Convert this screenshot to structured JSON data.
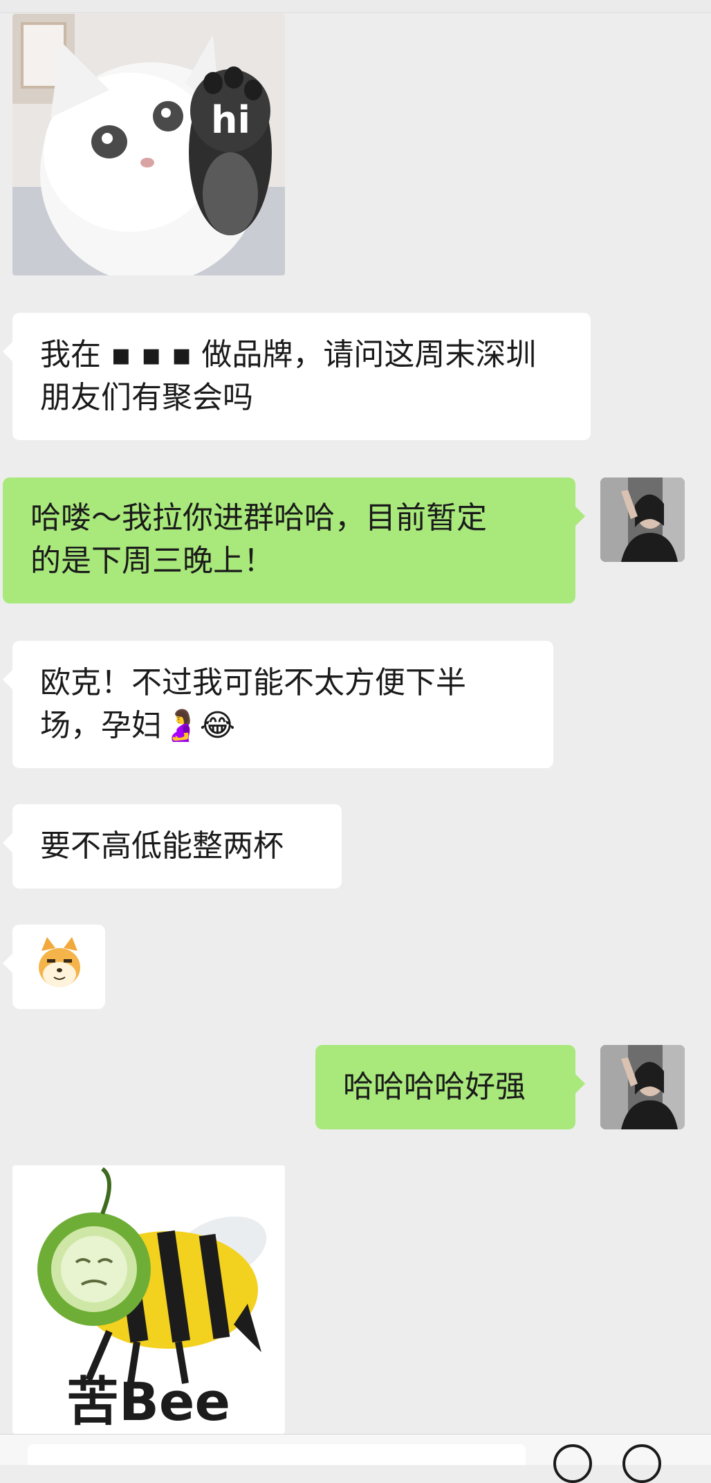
{
  "messages": [
    {
      "id": "m1",
      "sender": "other",
      "type": "sticker",
      "sticker_text": "hi",
      "icon": "cat-waving-sticker"
    },
    {
      "id": "m2",
      "sender": "other",
      "type": "text",
      "text": "我在 ▪ ▪ ▪ 做品牌，请问这周末深圳\n朋友们有聚会吗"
    },
    {
      "id": "m3",
      "sender": "me",
      "type": "text",
      "text": "哈喽～我拉你进群哈哈，目前暂定\n的是下周三晚上！"
    },
    {
      "id": "m4",
      "sender": "other",
      "type": "text",
      "text": "欧克！不过我可能不太方便下半\n场，孕妇🤰😂"
    },
    {
      "id": "m5",
      "sender": "other",
      "type": "text",
      "text": "要不高低能整两杯"
    },
    {
      "id": "m6",
      "sender": "other",
      "type": "emoji",
      "icon": "doge-emoji"
    },
    {
      "id": "m7",
      "sender": "me",
      "type": "text",
      "text": "哈哈哈哈好强"
    },
    {
      "id": "m8",
      "sender": "other",
      "type": "sticker",
      "sticker_text": "苦Bee",
      "icon": "bitter-bee-sticker"
    }
  ],
  "colors": {
    "background": "#ededed",
    "incoming_bubble": "#ffffff",
    "outgoing_bubble": "#a9e97c",
    "text": "#1a1a1a"
  }
}
